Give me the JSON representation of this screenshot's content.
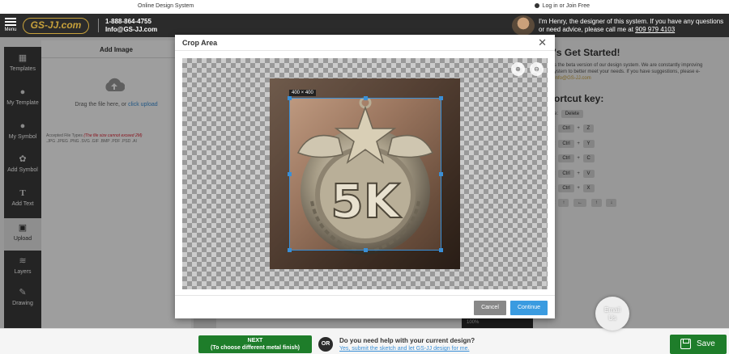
{
  "topbar": {
    "center_text": "Online Design System",
    "login_text": "Log in",
    "or_text": "or",
    "join_text": "Join Free"
  },
  "header": {
    "menu_label": "Menu",
    "logo_text": "GS-JJ.com",
    "phone": "1-888-864-4755",
    "email": "Info@GS-JJ.com",
    "designer_text": "I'm Henry, the designer of this system. If you have any questions or need advice, please call me at",
    "designer_phone": "909 979 4103"
  },
  "sidebar": {
    "items": [
      {
        "label": "Templates",
        "icon": "grid-icon"
      },
      {
        "label": "My Template",
        "icon": "user-icon"
      },
      {
        "label": "My Symbol",
        "icon": "user-icon"
      },
      {
        "label": "Add Symbol",
        "icon": "shapes-icon"
      },
      {
        "label": "Add Text",
        "icon": "text-icon"
      },
      {
        "label": "Upload",
        "icon": "image-icon"
      },
      {
        "label": "Layers",
        "icon": "layers-icon"
      },
      {
        "label": "Drawing",
        "icon": "pencil-icon"
      }
    ]
  },
  "add_image": {
    "title": "Add Image",
    "drag_text": "Drag the file here, or",
    "upload_link": "click upload",
    "accepted_label": "Accepted File Types",
    "accepted_warning": "(The file size cannot exceed 2M)",
    "accepted_types": ".JPG .JPEG .PNG .SVG .GIF .BMP .PDF .PSD .AI"
  },
  "right_panel": {
    "title": "'s Get Started!",
    "text_1": "s the beta version of our design system. We are constantly improving",
    "text_2": "ystem to better meet your needs. If you have suggestions, please e-",
    "text_3": "Info@GS-JJ.com",
    "shortcut_title": "ortcut key:",
    "delete_prefix": "e:",
    "delete_key": "Delete",
    "shortcuts": [
      {
        "prefix": ":",
        "mod": "Ctrl",
        "plus": "+",
        "key": "Z"
      },
      {
        "prefix": ":",
        "mod": "Ctrl",
        "plus": "+",
        "key": "Y"
      },
      {
        "prefix": ":",
        "mod": "Ctrl",
        "plus": "+",
        "key": "C"
      },
      {
        "prefix": ":",
        "mod": "Ctrl",
        "plus": "+",
        "key": "V"
      },
      {
        "prefix": ":",
        "mod": "Ctrl",
        "plus": "+",
        "key": "X"
      }
    ],
    "arrow_prefix": ":",
    "arrows": [
      "↑",
      "←",
      "↑",
      "↓"
    ]
  },
  "modal": {
    "title": "Crop Area",
    "size_tag": "400 × 400",
    "cancel_label": "Cancel",
    "continue_label": "Continue",
    "medal_text": "5K"
  },
  "floating": {
    "email_line1": "Email",
    "email_line2": "Us",
    "zoom_text": "100%"
  },
  "bottombar": {
    "next_line1": "NEXT",
    "next_line2": "(To choose different metal finish)",
    "or": "OR",
    "help_question": "Do you need help with your current design?",
    "help_link": "Yes, submit the sketch and let GS-JJ design for me.",
    "save_label": "Save"
  },
  "colors": {
    "accent_green": "#1e7d2a",
    "accent_blue": "#3a9be0",
    "gold": "#c7a13b",
    "header_bg": "#2b2b2b"
  }
}
